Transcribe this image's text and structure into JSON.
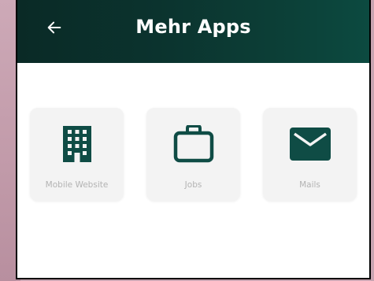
{
  "appbar": {
    "title": "Mehr Apps",
    "back_icon": "arrow-left-icon"
  },
  "colors": {
    "appbar_start": "#0a2a26",
    "appbar_end": "#0c4a40",
    "icon": "#0f4c45",
    "tile_bg": "#f3f3f3",
    "label": "#b3b3b3"
  },
  "apps": [
    {
      "label": "Mobile Website",
      "icon": "building-icon"
    },
    {
      "label": "Jobs",
      "icon": "briefcase-icon"
    },
    {
      "label": "Mails",
      "icon": "envelope-icon"
    }
  ]
}
